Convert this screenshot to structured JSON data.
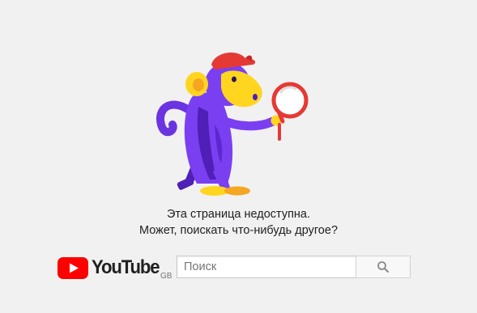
{
  "error": {
    "line1": "Эта страница недоступна.",
    "line2": "Может, поискать что-нибудь другое?"
  },
  "logo": {
    "wordmark": "YouTube",
    "country_code": "GB"
  },
  "search": {
    "placeholder": "Поиск",
    "value": ""
  },
  "colors": {
    "background": "#f1f1f1",
    "youtube_red": "#ff0000",
    "monkey_purple": "#7b3ff2",
    "monkey_dark_purple": "#4f1fb8",
    "monkey_face_yellow": "#ffd51f",
    "cap_red": "#e53935",
    "feet_orange": "#f5a623"
  },
  "icons": {
    "illustration": "monkey-with-magnifier",
    "search_button": "search-icon",
    "logo": "youtube-play-logo"
  }
}
